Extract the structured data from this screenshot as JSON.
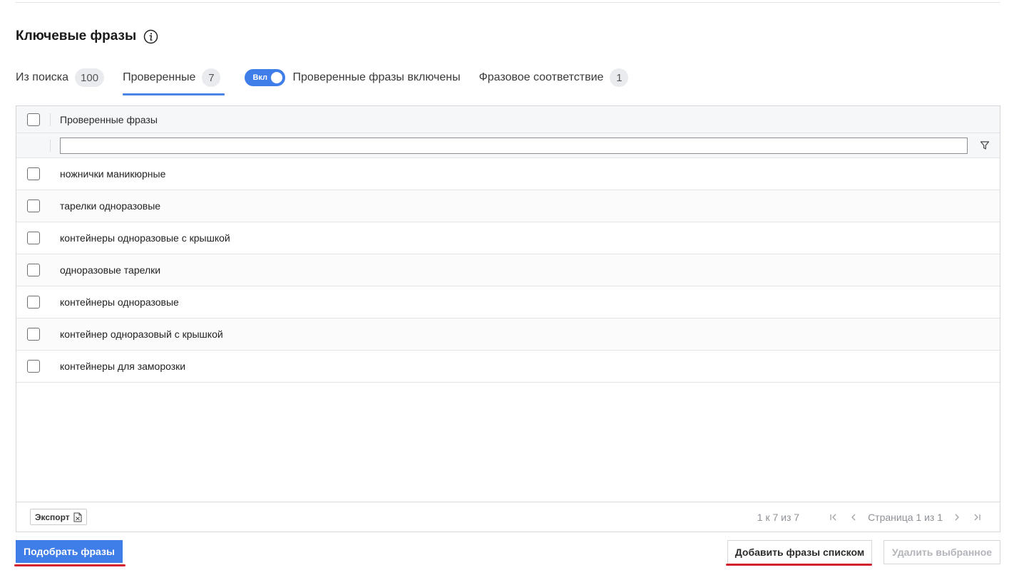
{
  "section": {
    "title": "Ключевые фразы",
    "info_icon": "info-icon"
  },
  "tabs": [
    {
      "label": "Из поиска",
      "count": "100",
      "active": false
    },
    {
      "label": "Проверенные",
      "count": "7",
      "active": true
    }
  ],
  "toggle": {
    "state_label": "Вкл",
    "description": "Проверенные фразы включены",
    "on": true
  },
  "tab_phrase_match": {
    "label": "Фразовое соответствие",
    "count": "1"
  },
  "grid": {
    "column_header": "Проверенные фразы",
    "filter_value": "",
    "rows": [
      "ножнички маникюрные",
      "тарелки одноразовые",
      "контейнеры одноразовые с крышкой",
      "одноразовые тарелки",
      "контейнеры одноразовые",
      "контейнер одноразовый с крышкой",
      "контейнеры для заморозки"
    ]
  },
  "footer": {
    "export_label": "Экспорт",
    "summary": "1 к 7 из 7",
    "page_text": "Страница 1 из 1"
  },
  "actions": {
    "pick_label": "Подобрать фразы",
    "add_list_label": "Добавить фразы списком",
    "delete_label": "Удалить выбранное"
  },
  "colors": {
    "accent": "#3f7de8",
    "underline_marker": "#d21f2e"
  }
}
